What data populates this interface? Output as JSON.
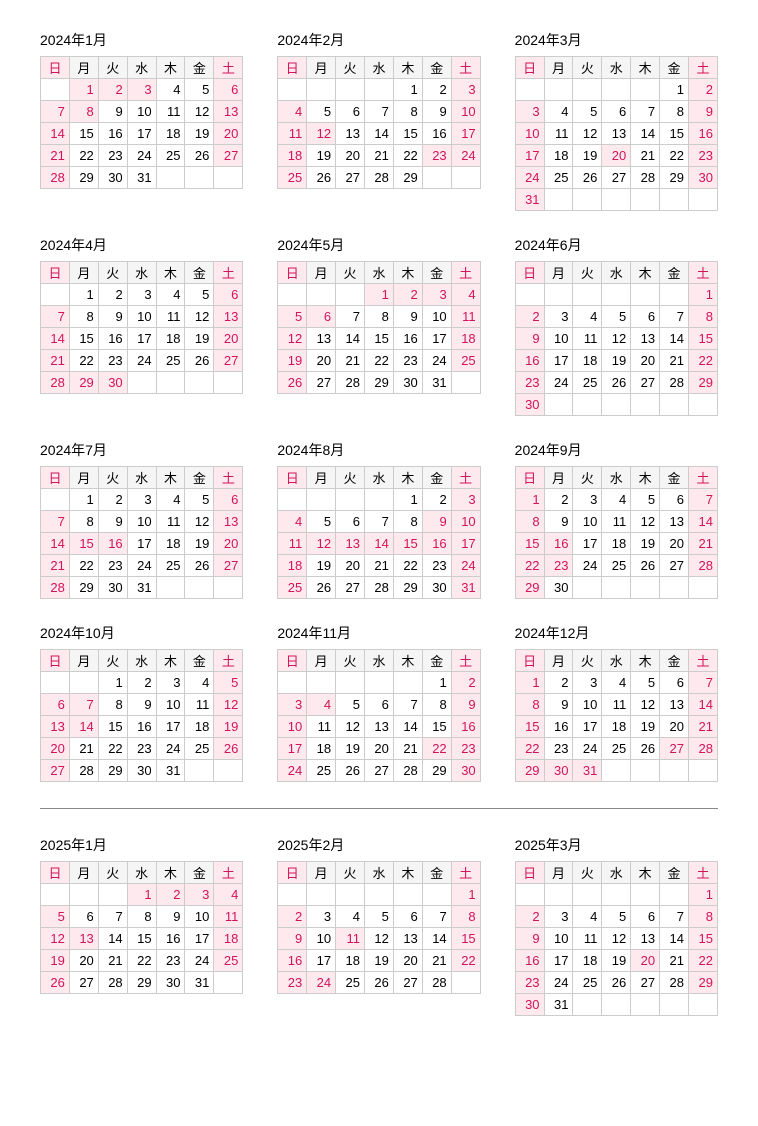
{
  "dow": [
    "日",
    "月",
    "火",
    "水",
    "木",
    "金",
    "土"
  ],
  "months": [
    {
      "title": "2024年1月",
      "start": 1,
      "days": 31,
      "hol": [
        1,
        2,
        3,
        8
      ]
    },
    {
      "title": "2024年2月",
      "start": 4,
      "days": 29,
      "hol": [
        12,
        23
      ]
    },
    {
      "title": "2024年3月",
      "start": 5,
      "days": 31,
      "hol": [
        20
      ]
    },
    {
      "title": "2024年4月",
      "start": 1,
      "days": 30,
      "hol": [
        29,
        30
      ]
    },
    {
      "title": "2024年5月",
      "start": 3,
      "days": 31,
      "hol": [
        1,
        2,
        3,
        6
      ]
    },
    {
      "title": "2024年6月",
      "start": 6,
      "days": 30,
      "hol": []
    },
    {
      "title": "2024年7月",
      "start": 1,
      "days": 31,
      "hol": [
        15,
        16
      ]
    },
    {
      "title": "2024年8月",
      "start": 4,
      "days": 31,
      "hol": [
        9,
        12,
        13,
        14,
        15,
        16
      ]
    },
    {
      "title": "2024年9月",
      "start": 0,
      "days": 30,
      "hol": [
        16,
        23
      ]
    },
    {
      "title": "2024年10月",
      "start": 2,
      "days": 31,
      "hol": [
        7,
        14
      ]
    },
    {
      "title": "2024年11月",
      "start": 5,
      "days": 30,
      "hol": [
        4,
        22,
        23
      ]
    },
    {
      "title": "2024年12月",
      "start": 0,
      "days": 31,
      "hol": [
        27,
        30,
        31
      ]
    },
    {
      "title": "2025年1月",
      "start": 3,
      "days": 31,
      "hol": [
        1,
        2,
        3,
        13
      ]
    },
    {
      "title": "2025年2月",
      "start": 6,
      "days": 28,
      "hol": [
        11,
        24
      ]
    },
    {
      "title": "2025年3月",
      "start": 6,
      "days": 31,
      "hol": [
        20
      ]
    }
  ],
  "separator_after_index": 12
}
